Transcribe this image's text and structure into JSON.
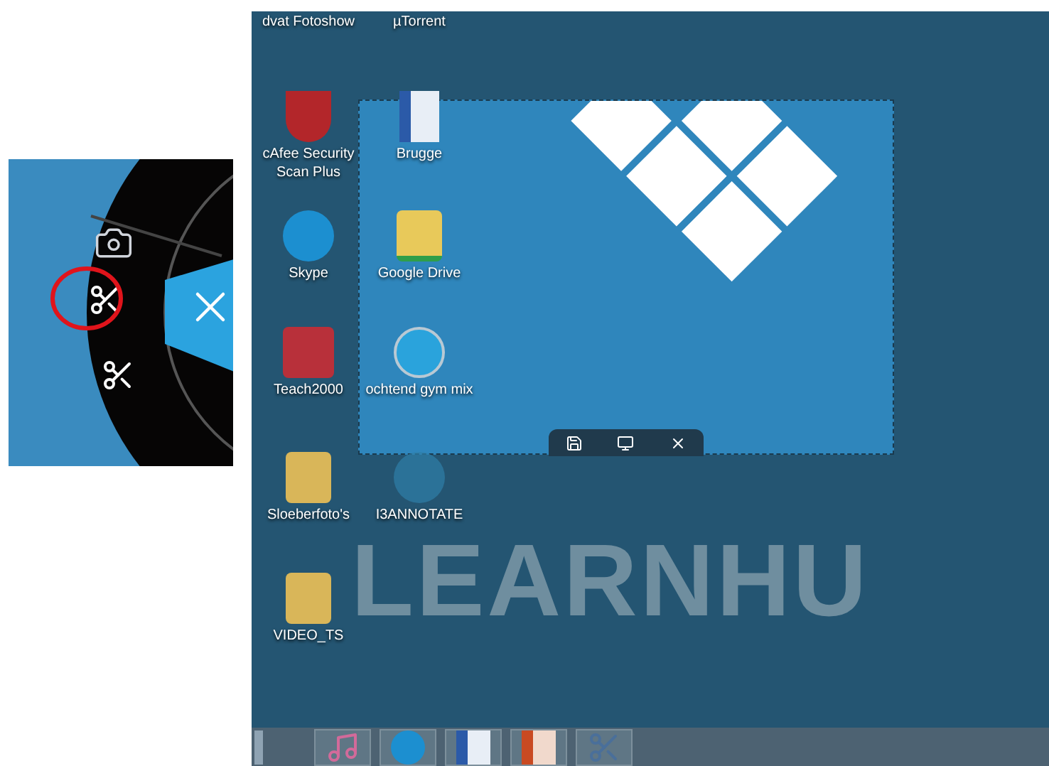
{
  "desktop": {
    "icons": [
      {
        "kind": "fotoshow",
        "lines": [
          "dvat Fotoshow"
        ]
      },
      {
        "kind": "mcafee",
        "lines": [
          "cAfee Security",
          "Scan Plus"
        ]
      },
      {
        "kind": "skype",
        "lines": [
          "Skype"
        ]
      },
      {
        "kind": "teach",
        "lines": [
          "Teach2000"
        ]
      },
      {
        "kind": "folder",
        "lines": [
          "Sloeberfoto's"
        ]
      },
      {
        "kind": "folder",
        "lines": [
          "VIDEO_TS"
        ]
      },
      {
        "kind": "torrent",
        "lines": [
          "µTorrent"
        ]
      },
      {
        "kind": "word",
        "lines": [
          "Brugge"
        ]
      },
      {
        "kind": "drive",
        "lines": [
          "Google Drive"
        ]
      },
      {
        "kind": "bs",
        "lines": [
          "ochtend gym mix"
        ]
      },
      {
        "kind": "annotate",
        "lines": [
          "I3ANNOTATE"
        ]
      }
    ],
    "wallpaper_text": "LEARNHU"
  },
  "taskbar": {
    "items": [
      {
        "kind": "itunes"
      },
      {
        "kind": "skype"
      },
      {
        "kind": "word"
      },
      {
        "kind": "powerpoint"
      },
      {
        "kind": "snip"
      }
    ]
  }
}
